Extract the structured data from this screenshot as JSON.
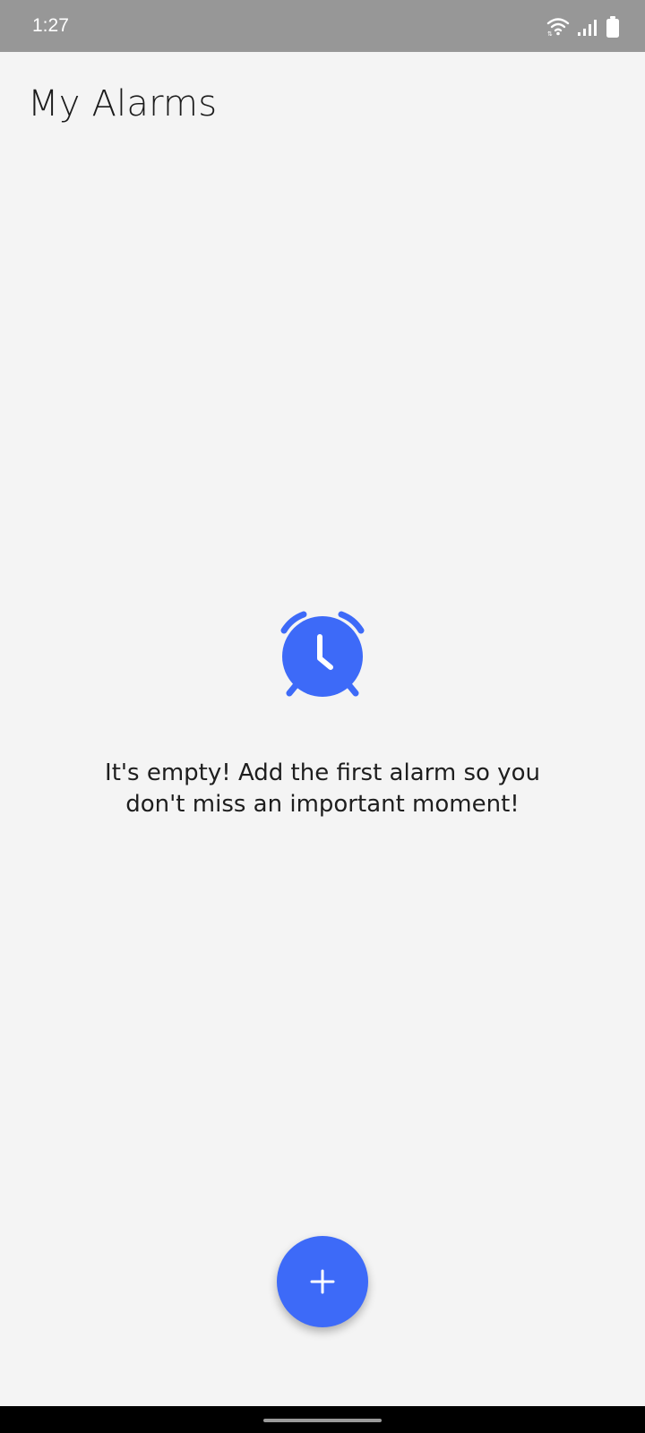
{
  "status_bar": {
    "time": "1:27",
    "icons": [
      "wifi-icon",
      "signal-icon",
      "battery-icon"
    ],
    "background": "#979797"
  },
  "header": {
    "title": "My Alarms"
  },
  "empty_state": {
    "icon": "alarm-clock-icon",
    "message": "It's empty! Add the first alarm so you don't miss an important moment!"
  },
  "fab": {
    "icon": "plus-icon",
    "color": "#3d6af8"
  },
  "colors": {
    "accent": "#3d6af8",
    "background": "#f4f4f4",
    "text": "#1e1e1e"
  }
}
